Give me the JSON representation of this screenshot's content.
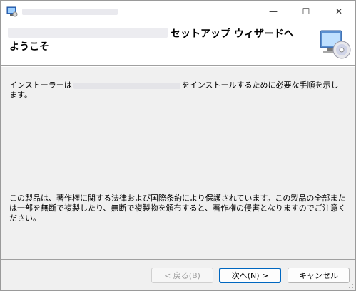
{
  "window": {
    "controls": {
      "minimize": "—",
      "maximize": "☐",
      "close": "✕"
    }
  },
  "header": {
    "title_line1": "セットアップ ウィザードへ",
    "title_line2": "ようこそ"
  },
  "body": {
    "intro_prefix": "インストーラーは",
    "intro_suffix": "をインストールするために必要な手順を示し",
    "intro_line2": "ます。",
    "copyright": "この製品は、著作権に関する法律および国際条約により保護されています。この製品の全部または一部を無断で複製したり、無断で複製物を頒布すると、著作権の侵害となりますのでご注意ください。"
  },
  "footer": {
    "back_label": "< 戻る(B)",
    "next_label": "次へ(N) >",
    "cancel_label": "キャンセル"
  },
  "colors": {
    "accent": "#0067c0",
    "dialog_bg": "#f0f0f0",
    "header_bg": "#ffffff"
  },
  "icons": {
    "app": "installer-icon",
    "header": "computer-cd-icon"
  }
}
